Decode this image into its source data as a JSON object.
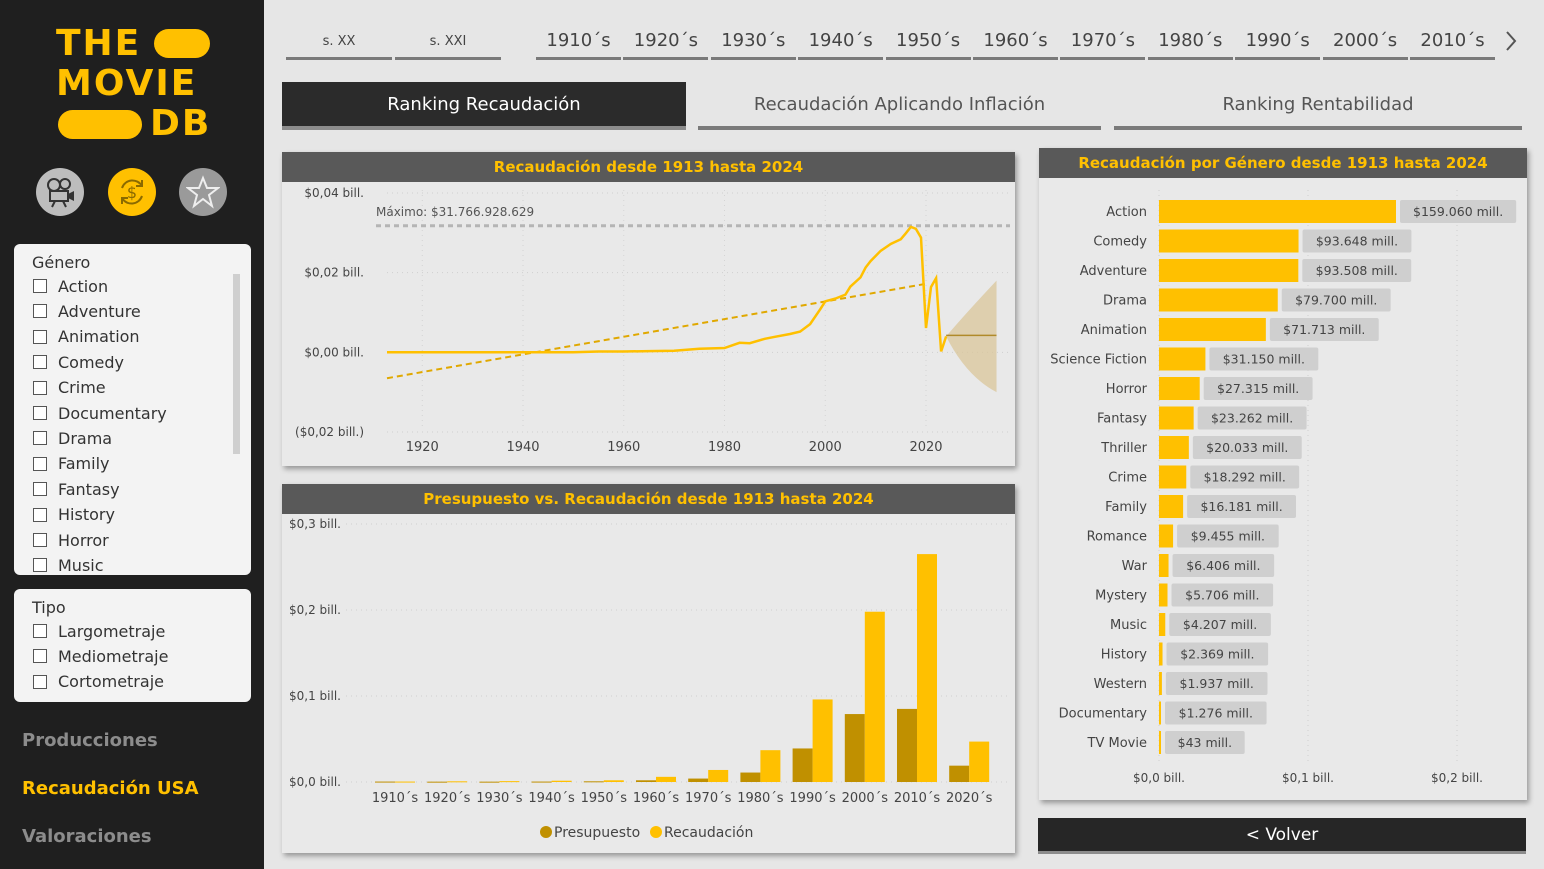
{
  "logo": {
    "line1": "THE",
    "line2": "MOVIE",
    "line3": "DB"
  },
  "colors": {
    "accent": "#ffc000",
    "dark": "#1f1f1f",
    "budget": "#c09000",
    "header": "#595959"
  },
  "icons": [
    "film-projector-icon",
    "dollar-refresh-icon",
    "star-icon"
  ],
  "genre_filter": {
    "title": "Género",
    "items": [
      "Action",
      "Adventure",
      "Animation",
      "Comedy",
      "Crime",
      "Documentary",
      "Drama",
      "Family",
      "Fantasy",
      "History",
      "Horror",
      "Music"
    ]
  },
  "type_filter": {
    "title": "Tipo",
    "items": [
      "Largometraje",
      "Mediometraje",
      "Cortometraje"
    ]
  },
  "nav": {
    "producciones": "Producciones",
    "recaudacion": "Recaudación USA",
    "valoraciones": "Valoraciones"
  },
  "centuries": [
    "s. XX",
    "s. XXI"
  ],
  "decades": [
    "1910´s",
    "1920´s",
    "1930´s",
    "1940´s",
    "1950´s",
    "1960´s",
    "1970´s",
    "1980´s",
    "1990´s",
    "2000´s",
    "2010´s"
  ],
  "view_tabs": [
    "Ranking Recaudación",
    "Recaudación Aplicando Inflación",
    "Ranking Rentabilidad"
  ],
  "volver": "< Volver",
  "chart_data": [
    {
      "type": "line",
      "title": "Recaudación desde 1913 hasta 2024",
      "annotation": "Máximo: $31.766.928.629",
      "max_value": 31766928629,
      "ylim": [
        -0.02,
        0.04
      ],
      "xlim": [
        1913,
        2035
      ],
      "y_ticks": [
        {
          "v": 0.04,
          "label": "$0,04 bill."
        },
        {
          "v": 0.02,
          "label": "$0,02 bill."
        },
        {
          "v": 0.0,
          "label": "$0,00 bill."
        },
        {
          "v": -0.02,
          "label": "($0,02 bill.)"
        }
      ],
      "x_ticks": [
        1920,
        1940,
        1960,
        1980,
        2000,
        2020
      ],
      "grid": true,
      "series": [
        {
          "x": [
            1913,
            1920,
            1930,
            1938,
            1940,
            1945,
            1950,
            1955,
            1960,
            1965,
            1970,
            1975,
            1980,
            1983,
            1985,
            1988,
            1990,
            1993,
            1995,
            1997,
            1999,
            2000,
            2002,
            2004,
            2005,
            2007,
            2008,
            2009,
            2011,
            2013,
            2015,
            2016,
            2017,
            2018,
            2019,
            2020,
            2021,
            2022,
            2023
          ],
          "y": [
            0.0,
            0.0,
            0.0,
            0.0,
            0.0,
            0.0,
            0.0,
            0.0002,
            0.0002,
            0.0003,
            0.0004,
            0.0009,
            0.0011,
            0.0024,
            0.0023,
            0.0034,
            0.0039,
            0.0046,
            0.0052,
            0.0071,
            0.0108,
            0.0128,
            0.0135,
            0.0145,
            0.0165,
            0.0188,
            0.0213,
            0.0229,
            0.0255,
            0.0272,
            0.0284,
            0.0299,
            0.0315,
            0.031,
            0.0288,
            0.0061,
            0.0164,
            0.0186,
            0.0002
          ]
        }
      ],
      "trend": {
        "x": [
          1913,
          2020
        ],
        "y": [
          -0.0065,
          0.0172
        ]
      },
      "forecast": {
        "x_start": 2024,
        "x_end": 2034,
        "value": 0.004,
        "upper_end": 0.018,
        "lower_end": -0.01
      }
    },
    {
      "type": "bar",
      "title": "Presupuesto vs. Recaudación desde 1913 hasta 2024",
      "categories": [
        "1910´s",
        "1920´s",
        "1930´s",
        "1940´s",
        "1950´s",
        "1960´s",
        "1970´s",
        "1980´s",
        "1990´s",
        "2000´s",
        "2010´s",
        "2020´s"
      ],
      "series": [
        {
          "name": "Presupuesto",
          "values": [
            0.0005,
            0.0004,
            0.0004,
            0.0005,
            0.0008,
            0.002,
            0.004,
            0.011,
            0.039,
            0.079,
            0.085,
            0.019
          ]
        },
        {
          "name": "Recaudación",
          "values": [
            0.0005,
            0.0008,
            0.001,
            0.0015,
            0.002,
            0.006,
            0.014,
            0.037,
            0.096,
            0.198,
            0.265,
            0.047
          ]
        }
      ],
      "ylim": [
        0,
        0.3
      ],
      "y_ticks": [
        {
          "v": 0.3,
          "label": "$0,3 bill."
        },
        {
          "v": 0.2,
          "label": "$0,2 bill."
        },
        {
          "v": 0.1,
          "label": "$0,1 bill."
        },
        {
          "v": 0.0,
          "label": "$0,0 bill."
        }
      ],
      "legend": "bottom-center"
    },
    {
      "type": "bar",
      "orientation": "horizontal",
      "title": "Recaudación por Género desde 1913 hasta 2024",
      "categories": [
        "Action",
        "Comedy",
        "Adventure",
        "Drama",
        "Animation",
        "Science Fiction",
        "Horror",
        "Fantasy",
        "Thriller",
        "Crime",
        "Family",
        "Romance",
        "War",
        "Mystery",
        "Music",
        "History",
        "Western",
        "Documentary",
        "TV Movie"
      ],
      "values": [
        159060,
        93648,
        93508,
        79700,
        71713,
        31150,
        27315,
        23262,
        20033,
        18292,
        16181,
        9455,
        6406,
        5706,
        4207,
        2369,
        1937,
        1276,
        43
      ],
      "labels": [
        "$159.060 mill.",
        "$93.648 mill.",
        "$93.508 mill.",
        "$79.700 mill.",
        "$71.713 mill.",
        "$31.150 mill.",
        "$27.315 mill.",
        "$23.262 mill.",
        "$20.033 mill.",
        "$18.292 mill.",
        "$16.181 mill.",
        "$9.455 mill.",
        "$6.406 mill.",
        "$5.706 mill.",
        "$4.207 mill.",
        "$2.369 mill.",
        "$1.937 mill.",
        "$1.276 mill.",
        "$43 mill."
      ],
      "xlim": [
        0,
        200000
      ],
      "x_ticks": [
        {
          "v": 0,
          "label": "$0,0 bill."
        },
        {
          "v": 100000,
          "label": "$0,1 bill."
        },
        {
          "v": 200000,
          "label": "$0,2 bill."
        }
      ]
    }
  ]
}
